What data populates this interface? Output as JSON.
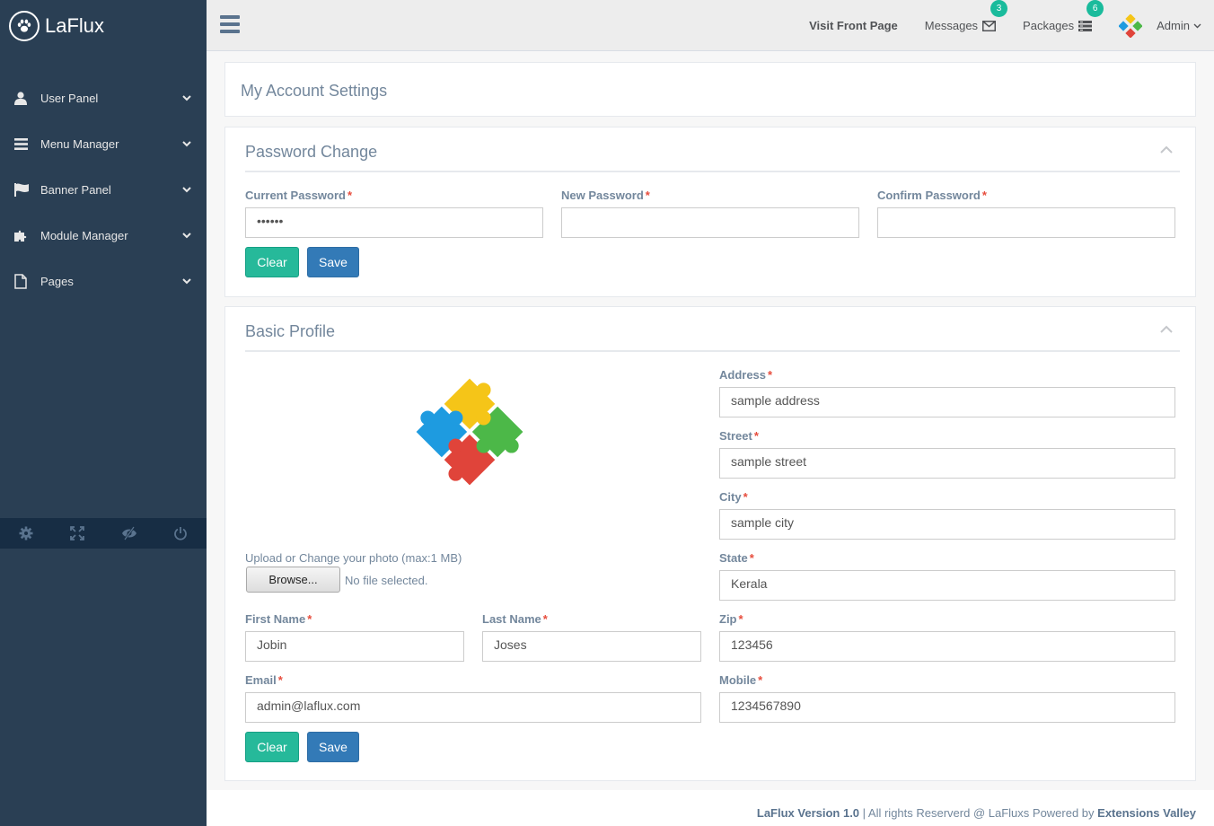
{
  "brand": {
    "name": "LaFlux",
    "logo_icon": "paw-icon"
  },
  "sidebar": {
    "items": [
      {
        "label": "User Panel",
        "icon": "user-icon"
      },
      {
        "label": "Menu Manager",
        "icon": "bars-icon"
      },
      {
        "label": "Banner Panel",
        "icon": "flag-icon"
      },
      {
        "label": "Module Manager",
        "icon": "puzzle-icon"
      },
      {
        "label": "Pages",
        "icon": "file-icon"
      }
    ],
    "footer_icons": [
      "gear-icon",
      "fullscreen-icon",
      "eye-slash-icon",
      "power-icon"
    ]
  },
  "topnav": {
    "visit": "Visit Front Page",
    "messages": {
      "label": "Messages",
      "count": "3"
    },
    "packages": {
      "label": "Packages",
      "count": "6"
    },
    "user": "Admin"
  },
  "page": {
    "title": "My Account Settings"
  },
  "password_panel": {
    "title": "Password Change",
    "current_label": "Current Password",
    "current_value": "••••••",
    "new_label": "New Password",
    "new_value": "",
    "confirm_label": "Confirm Password",
    "confirm_value": "",
    "clear": "Clear",
    "save": "Save"
  },
  "profile_panel": {
    "title": "Basic Profile",
    "upload_label": "Upload or Change your photo (max:1 MB)",
    "browse": "Browse...",
    "no_file": "No file selected.",
    "first_name_label": "First Name",
    "first_name": "Jobin",
    "last_name_label": "Last Name",
    "last_name": "Joses",
    "email_label": "Email",
    "email": "admin@laflux.com",
    "address_label": "Address",
    "address": "sample address",
    "street_label": "Street",
    "street": "sample street",
    "city_label": "City",
    "city": "sample city",
    "state_label": "State",
    "state": "Kerala",
    "zip_label": "Zip",
    "zip": "123456",
    "mobile_label": "Mobile",
    "mobile": "1234567890",
    "clear": "Clear",
    "save": "Save"
  },
  "footer": {
    "version": "LaFlux Version 1.0",
    "rights": " | All rights Reserverd @ LaFluxs Powered by ",
    "company": "Extensions Valley"
  },
  "required_mark": "*",
  "colors": {
    "sidebar": "#2A3F54",
    "accent_green": "#26B99A",
    "accent_blue": "#337AB7",
    "required": "#E74C3C"
  }
}
